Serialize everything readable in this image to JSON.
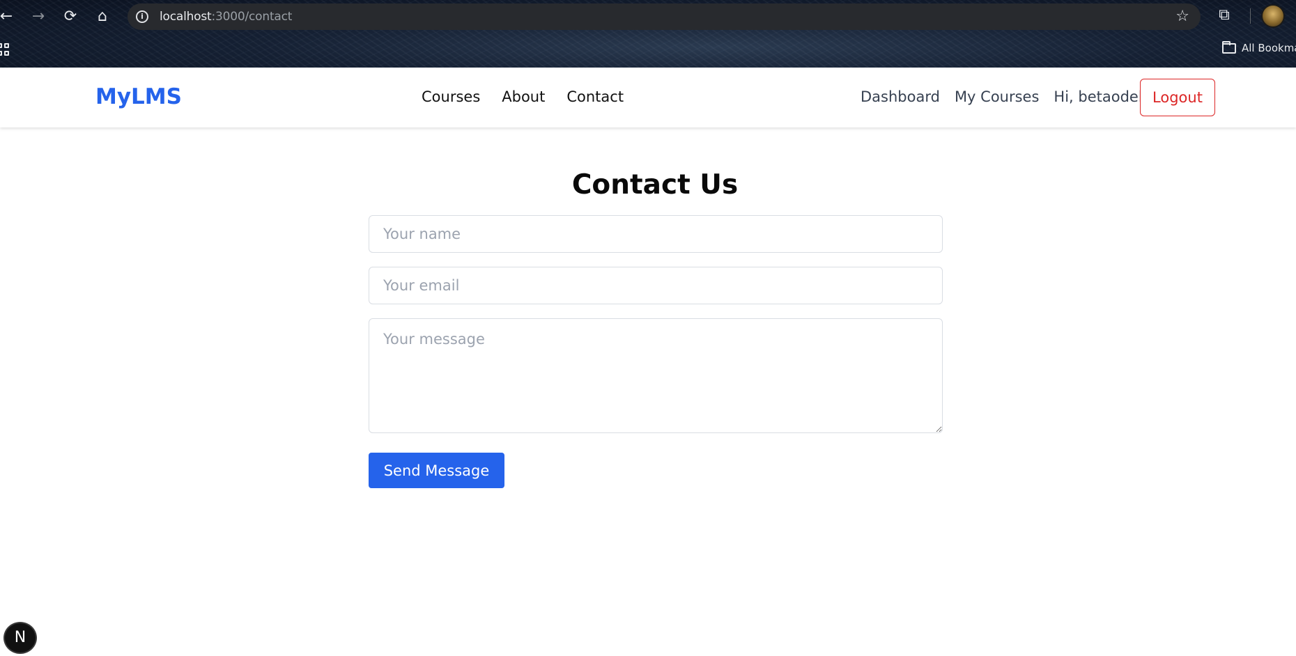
{
  "browser": {
    "back_icon": "←",
    "forward_icon": "→",
    "reload_icon": "⟳",
    "home_icon": "⌂",
    "info_icon": "i",
    "url_host": "localhost",
    "url_path": ":3000/contact",
    "star_icon": "☆",
    "extensions_icon": "⧉",
    "bookmarks_label": "All Bookma"
  },
  "navbar": {
    "logo": "MyLMS",
    "center_links": [
      "Courses",
      "About",
      "Contact"
    ],
    "dashboard": "Dashboard",
    "my_courses": "My Courses",
    "greeting": "Hi, betaodelta",
    "logout": "Logout"
  },
  "contact": {
    "title": "Contact Us",
    "name_placeholder": "Your name",
    "email_placeholder": "Your email",
    "message_placeholder": "Your message",
    "submit": "Send Message"
  },
  "dev_badge": "N",
  "colors": {
    "brand": "#2563eb",
    "logout": "#dc2626",
    "submit_bg": "#2563eb"
  }
}
